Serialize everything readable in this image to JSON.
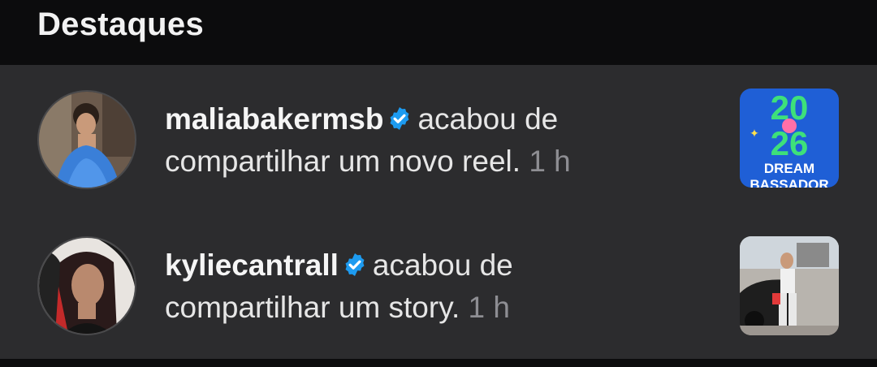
{
  "header": {
    "title": "Destaques"
  },
  "notifications": [
    {
      "username": "maliabakermsb",
      "verified": true,
      "message_line1": "acabou de",
      "message_line2": "compartilhar um novo reel.",
      "time": "1 h",
      "thumbnail": {
        "line1": "20",
        "line2": "26",
        "line3": "DREAM",
        "line4": "BASSADOR"
      }
    },
    {
      "username": "kyliecantrall",
      "verified": true,
      "message_line1": "acabou de",
      "message_line2": "compartilhar um story.",
      "time": "1 h"
    }
  ],
  "colors": {
    "header_bg": "#0c0c0d",
    "panel_bg": "#2c2c2e",
    "verified_blue": "#1d9bf0",
    "time_gray": "#8e8e93"
  }
}
